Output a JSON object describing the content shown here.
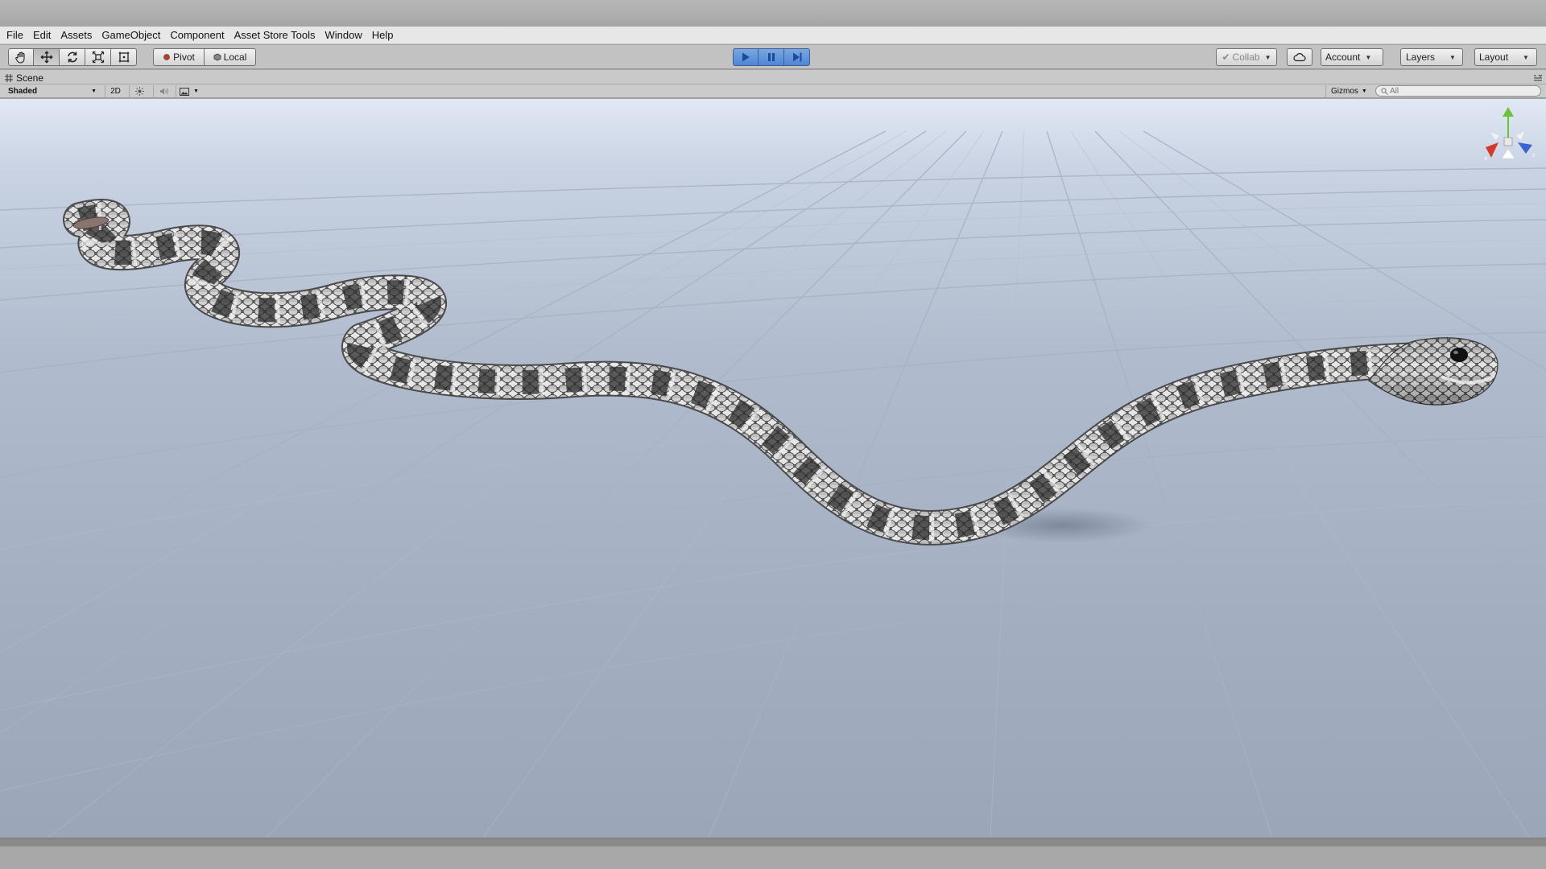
{
  "menu": [
    "File",
    "Edit",
    "Assets",
    "GameObject",
    "Component",
    "Asset Store Tools",
    "Window",
    "Help"
  ],
  "toolbar": {
    "tools": [
      "hand-icon",
      "move-icon",
      "rotate-icon",
      "scale-icon",
      "rect-icon"
    ],
    "pivot_label": "Pivot",
    "local_label": "Local",
    "play_controls": [
      "play-icon",
      "pause-icon",
      "step-icon"
    ],
    "collab_label": "Collab",
    "account_label": "Account",
    "layers_label": "Layers",
    "layout_label": "Layout"
  },
  "scene": {
    "tab_label": "Scene",
    "shading_mode": "Shaded",
    "mode_2d_label": "2D",
    "gizmos_label": "Gizmos",
    "search_placeholder": "All"
  },
  "colors": {
    "play_active": "#4f86d4",
    "gizmo_x": "#d23a2a",
    "gizmo_y": "#6ac33a",
    "gizmo_z": "#3a64d2"
  }
}
